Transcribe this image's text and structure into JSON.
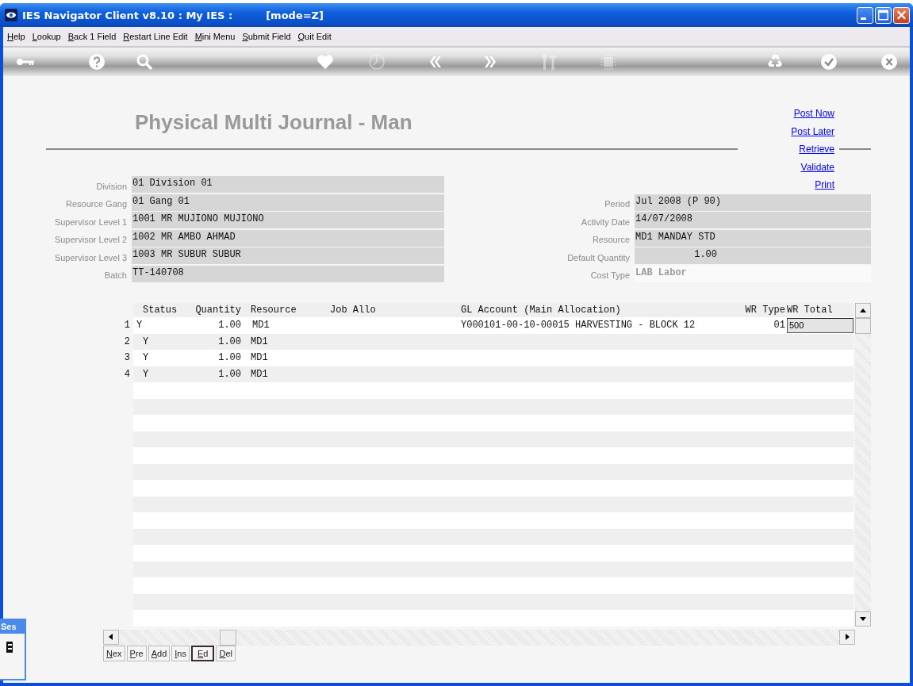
{
  "window": {
    "title": "IES Navigator Client v8.10 : My IES :",
    "mode": "[mode=Z]"
  },
  "menu": [
    "Help",
    "Lookup",
    "Back 1 Field",
    "Restart Line Edit",
    "Mini Menu",
    "Submit Field",
    "Quit Edit"
  ],
  "toolbar": [
    {
      "disabled": false
    },
    {
      "disabled": false
    },
    {
      "disabled": false
    },
    {
      "disabled": false
    },
    {
      "disabled": true
    },
    {
      "disabled": false
    },
    {
      "disabled": false
    },
    {
      "disabled": true
    },
    {
      "disabled": true
    },
    {
      "disabled": false
    },
    {
      "disabled": false
    },
    {
      "disabled": false
    }
  ],
  "page_title": "Physical Multi Journal - Man",
  "actions": [
    "Post Now",
    "Post Later",
    "Retrieve",
    "Validate",
    "Print"
  ],
  "left_fields": [
    {
      "label": "Division",
      "value": "01 Division 01"
    },
    {
      "label": "Resource Gang",
      "value": "01 Gang 01"
    },
    {
      "label": "Supervisor Level 1",
      "value": "1001 MR MUJIONO MUJIONO"
    },
    {
      "label": "Supervisor Level 2",
      "value": "1002 MR AMBO AHMAD"
    },
    {
      "label": "Supervisor Level 3",
      "value": "1003 MR SUBUR SUBUR"
    },
    {
      "label": "Batch",
      "value": "TT-140708"
    }
  ],
  "right_fields": [
    {
      "label": "Period",
      "value": "Jul 2008 (P 90)",
      "kind": "text",
      "disabled": false
    },
    {
      "label": "Activity Date",
      "value": "14/07/2008",
      "kind": "text",
      "disabled": false
    },
    {
      "label": "Resource",
      "value": "MD1 MANDAY STD",
      "kind": "text",
      "disabled": false
    },
    {
      "label": "Default Quantity",
      "value": "1.00",
      "kind": "number",
      "disabled": false
    },
    {
      "label": "Cost Type",
      "value": "LAB Labor",
      "kind": "text",
      "disabled": true
    }
  ],
  "table": {
    "columns": [
      "Status",
      "Quantity",
      "Resource",
      "Job Allo",
      "GL Account (Main Allocation)",
      "WR Type",
      "WR Total"
    ],
    "rows": [
      {
        "number": "1",
        "status": "Y",
        "quantity": "1.00",
        "resource": "MD1",
        "gl_account": "Y000101-00-10-00015 HARVESTING - BLOCK 12",
        "wr_type": "01",
        "wr_total": "500",
        "editing": true
      },
      {
        "number": "2",
        "status": "Y",
        "quantity": "1.00",
        "resource": "MD1",
        "editing": false
      },
      {
        "number": "3",
        "status": "Y",
        "quantity": "1.00",
        "resource": "MD1",
        "editing": false
      },
      {
        "number": "4",
        "status": "Y",
        "quantity": "1.00",
        "resource": "MD1",
        "editing": false
      }
    ]
  },
  "nav_buttons": [
    {
      "label": "Nex",
      "selected": false
    },
    {
      "label": "Pre",
      "selected": false
    },
    {
      "label": "Add",
      "selected": false
    },
    {
      "label": "Ins",
      "selected": false
    },
    {
      "label": "Ed",
      "selected": true
    },
    {
      "label": "Del",
      "selected": false
    }
  ],
  "session_panel": {
    "title": "Ses"
  }
}
